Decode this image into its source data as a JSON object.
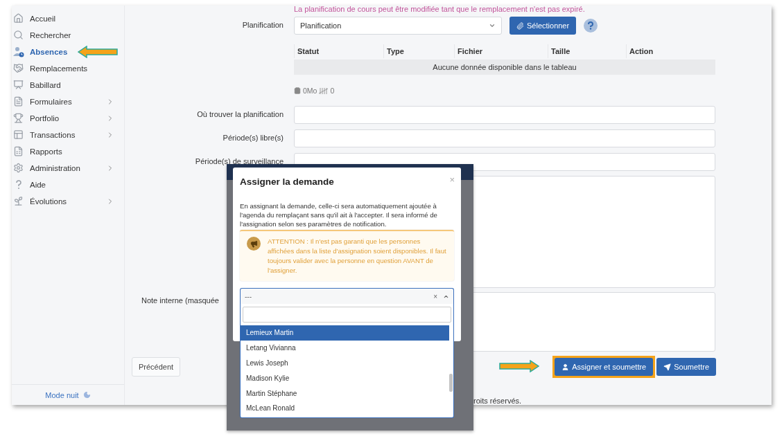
{
  "sidebar": {
    "items": [
      {
        "label": "Accueil",
        "selected": false,
        "has_submenu": false,
        "annotated": false
      },
      {
        "label": "Rechercher",
        "selected": false,
        "has_submenu": false,
        "annotated": false
      },
      {
        "label": "Absences",
        "selected": true,
        "has_submenu": false,
        "annotated": true
      },
      {
        "label": "Remplacements",
        "selected": false,
        "has_submenu": false,
        "annotated": false
      },
      {
        "label": "Babillard",
        "selected": false,
        "has_submenu": false,
        "annotated": false
      },
      {
        "label": "Formulaires",
        "selected": false,
        "has_submenu": true,
        "annotated": false
      },
      {
        "label": "Portfolio",
        "selected": false,
        "has_submenu": true,
        "annotated": false
      },
      {
        "label": "Transactions",
        "selected": false,
        "has_submenu": true,
        "annotated": false
      },
      {
        "label": "Rapports",
        "selected": false,
        "has_submenu": false,
        "annotated": false
      },
      {
        "label": "Administration",
        "selected": false,
        "has_submenu": true,
        "annotated": false
      },
      {
        "label": "Aide",
        "selected": false,
        "has_submenu": false,
        "annotated": false
      },
      {
        "label": "Évolutions",
        "selected": false,
        "has_submenu": true,
        "annotated": false
      }
    ],
    "night_mode": "Mode nuit"
  },
  "form": {
    "notice": "La planification de cours peut être modifiée tant que le remplacement n'est pas expiré.",
    "planning": {
      "label": "Planification",
      "value": "Planification",
      "select_button": "Sélectionner"
    },
    "table": {
      "columns": [
        "Statut",
        "Type",
        "Fichier",
        "Taille",
        "Action"
      ],
      "empty": "Aucune donnée disponible dans le tableau"
    },
    "stats": {
      "size": "0Mo",
      "count": "0"
    },
    "fields": [
      {
        "label": "Où trouver la planification",
        "kind": "input"
      },
      {
        "label": "Période(s) libre(s)",
        "kind": "input"
      },
      {
        "label": "Période(s) de surveillance",
        "kind": "input"
      },
      {
        "kind": "textarea"
      },
      {
        "label": "Note interne (masquée",
        "kind": "note"
      }
    ],
    "buttons": {
      "previous": "Précédent",
      "assign": {
        "label": "Assigner et soumettre",
        "annotated": true
      },
      "submit": "Soumettre"
    },
    "footer": "roits réservés."
  },
  "modal": {
    "title": "Assigner la demande",
    "close": "×",
    "text": "En assignant la demande, celle-ci sera automatiquement ajoutée à l'agenda du remplaçant sans qu'il ait à l'accepter. Il sera informé de l'assignation selon ses paramètres de notification.",
    "warning": "ATTENTION : Il n'est pas garanti que les personnes affichées dans la liste d'assignation soient disponibles. Il faut toujours valider avec la personne en question AVANT de l'assigner.",
    "select": {
      "value": "---",
      "clear": "×",
      "options": [
        {
          "label": "Lemieux Martin",
          "selected": true
        },
        {
          "label": "Letang Vivianna",
          "selected": false
        },
        {
          "label": "Lewis Joseph",
          "selected": false
        },
        {
          "label": "Madison Kylie",
          "selected": false
        },
        {
          "label": "Martin Stéphane",
          "selected": false
        },
        {
          "label": "McLean Ronald",
          "selected": false
        }
      ]
    }
  }
}
